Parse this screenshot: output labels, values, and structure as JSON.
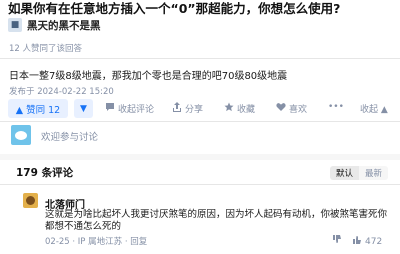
{
  "question": {
    "title": "如果你有在任意地方插入一个“0”那超能力，你想怎么使用?"
  },
  "answer": {
    "author": "黑天的黑不是黑",
    "meta": "12 人赞同了该回答",
    "content": "日本一整7级8级地震，那我加个零也是合理的吧70级80级地震",
    "published": "发布于 2024-02-22 15:20"
  },
  "actions": {
    "upvote": "▲ 赞同 12",
    "downvote": "▼",
    "comment": "收起评论",
    "share": "分享",
    "favorite": "收藏",
    "like": "喜欢",
    "collapse": "收起 ▲"
  },
  "comment_box": {
    "placeholder": "欢迎参与讨论"
  },
  "comments": {
    "count_title": "179 条评论",
    "sort_default": "默认",
    "sort_latest": "最新",
    "items": [
      {
        "author": "北落师门",
        "text": "这就是为啥比起坏人我更讨厌煞笔的原因，因为坏人起码有动机，你被煞笔害死你都想不通怎么死的",
        "meta": "02-25 · IP 属地江苏 · 回复",
        "likes": "472"
      }
    ]
  },
  "colors": {
    "accent": "#1772f6",
    "muted": "#8590a6"
  }
}
